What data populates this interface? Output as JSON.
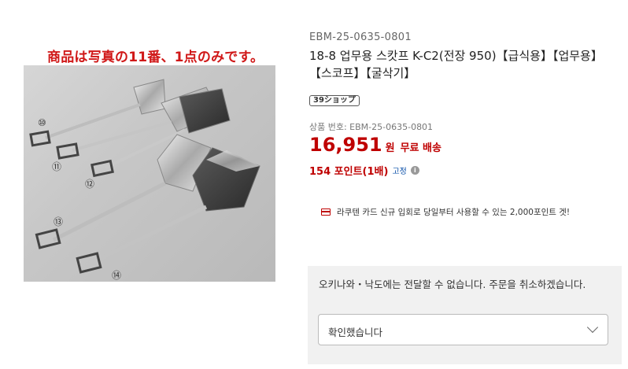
{
  "left": {
    "notice": "商品は写真の11番、1点のみです。",
    "image_numbers": [
      "⑩",
      "⑪",
      "⑫",
      "⑬",
      "⑭"
    ]
  },
  "product": {
    "sku_top": "EBM-25-0635-0801",
    "title": "18-8 업무용 스캇프 K-C2(전장 950)【급식용】【업무용】【스코프】【굴삭기】",
    "shop_badge": "39ショップ",
    "sku_line": "상품 번호: EBM-25-0635-0801",
    "price": "16,951",
    "price_unit": "원",
    "shipping": "무료 배송",
    "points": "154 포인트(1배)",
    "points_fixed": "고정",
    "card_promo": "라쿠텐 카드 신규 입회로 당일부터 사용할 수 있는 2,000포인트 겟!"
  },
  "option": {
    "message": "오키나와・낙도에는 전달할 수 없습니다. 주문을 취소하겠습니다.",
    "select_value": "확인했습니다"
  },
  "colors": {
    "price_red": "#bf0000",
    "link_blue": "#0a4fa8"
  }
}
